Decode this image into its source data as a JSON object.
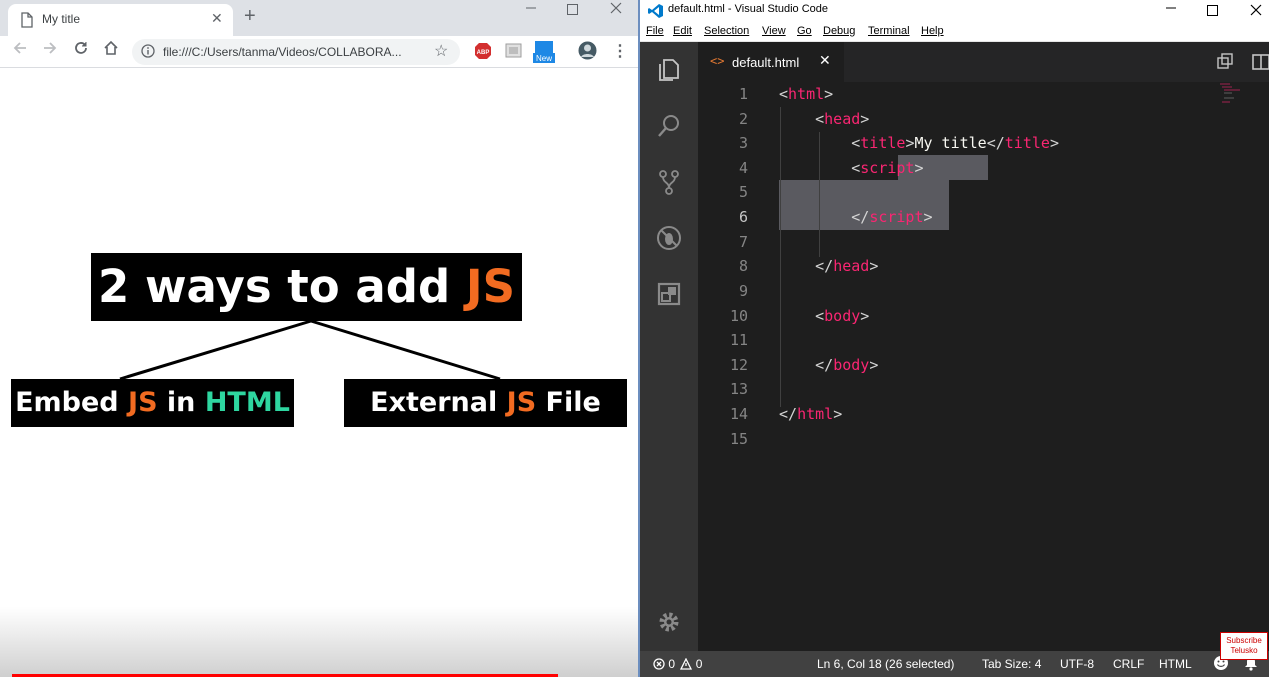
{
  "browser": {
    "tab_title": "My title",
    "url": "file:///C:/Users/tanma/Videos/COLLABORA...",
    "extension_badge": "New",
    "new_tab_symbol": "+",
    "close_symbol": "✕"
  },
  "slide": {
    "main_title": {
      "prefix": "2 ways to add ",
      "highlight": "JS"
    },
    "left_box": {
      "part1": "Embed ",
      "js": "JS",
      "part2": " in ",
      "html": "HTML"
    },
    "right_box": {
      "part1": "External ",
      "js": "JS",
      "part2": " File"
    },
    "colors": {
      "orange": "#f26b21",
      "green": "#2ed6a0",
      "box_bg": "#000000"
    }
  },
  "vscode": {
    "window_title": "default.html - Visual Studio Code",
    "menu": [
      "File",
      "Edit",
      "Selection",
      "View",
      "Go",
      "Debug",
      "Terminal",
      "Help"
    ],
    "tab_label": "default.html",
    "tab_icon": "<>",
    "line_numbers": [
      "1",
      "2",
      "3",
      "4",
      "5",
      "6",
      "7",
      "8",
      "9",
      "10",
      "11",
      "12",
      "13",
      "14",
      "15"
    ],
    "code": {
      "l1_tag": "html",
      "l2_tag": "head",
      "l3_open_tag": "title",
      "l3_text": "My title",
      "l3_close_tag": "title",
      "l4_tag": "script",
      "l6_tag": "script",
      "l8_tag": "head",
      "l10_tag": "body",
      "l12_tag": "body",
      "l14_tag": "html"
    },
    "status": {
      "errors": "0",
      "warnings": "0",
      "position": "Ln 6, Col 18 (26 selected)",
      "tab_size": "Tab Size: 4",
      "encoding": "UTF-8",
      "eol": "CRLF",
      "language": "HTML"
    },
    "watermark": {
      "line1": "Subscribe",
      "line2": "Telusko"
    }
  }
}
